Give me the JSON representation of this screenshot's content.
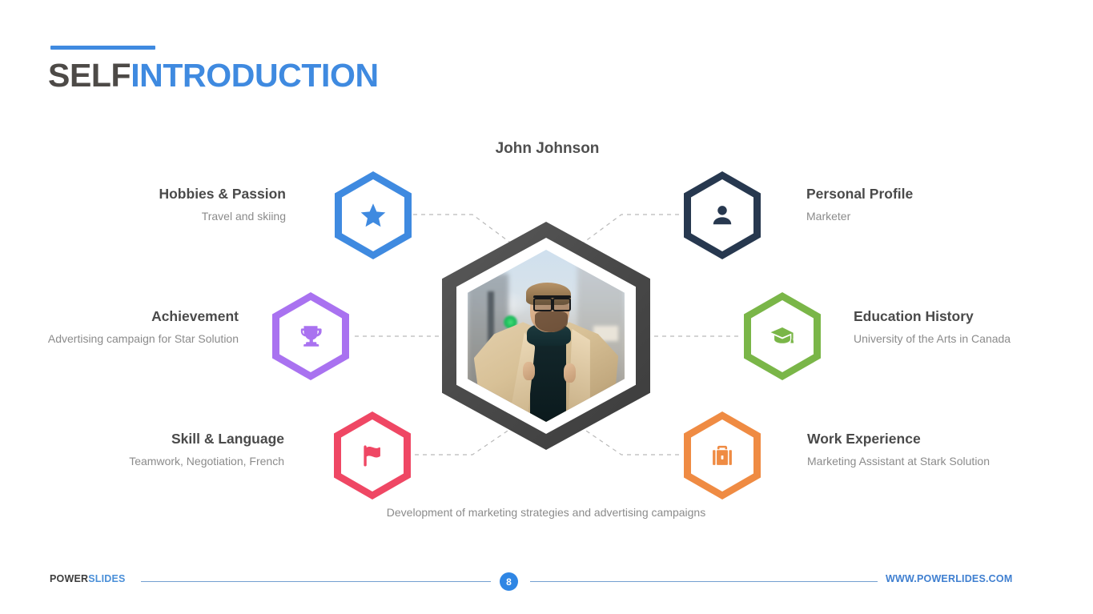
{
  "slide": {
    "title_part1": "SELF",
    "title_part2": "INTRODUCTION",
    "person_name": "John Johnson",
    "bottom_caption": "Development of marketing strategies and advertising campaigns"
  },
  "colors": {
    "accent_blue": "#3f8ae0",
    "title_dark": "#4d4a47",
    "hex_blue": "#3f8ae0",
    "hex_navy": "#27384f",
    "hex_purple": "#a濃",
    "hex_purple_hex": "#a972f0",
    "hex_green": "#7ab648",
    "hex_pink": "#ef4764",
    "hex_orange": "#ef8b43",
    "center_gray": "#4a4a4a",
    "body_gray": "#8b8b8b"
  },
  "entries": [
    {
      "key": "hobbies",
      "title": "Hobbies & Passion",
      "subtitle": "Travel and skiing",
      "icon": "star-icon",
      "color": "#3f8ae0",
      "side": "left"
    },
    {
      "key": "achievement",
      "title": "Achievement",
      "subtitle": "Advertising campaign for Star Solution",
      "icon": "trophy-icon",
      "color": "#a972f0",
      "side": "left"
    },
    {
      "key": "skill",
      "title": "Skill & Language",
      "subtitle": "Teamwork, Negotiation, French",
      "icon": "flag-icon",
      "color": "#ef4764",
      "side": "left"
    },
    {
      "key": "personal-profile",
      "title": "Personal Profile",
      "subtitle": "Marketer",
      "icon": "user-icon",
      "color": "#27384f",
      "side": "right"
    },
    {
      "key": "education",
      "title": "Education History",
      "subtitle": "University of the Arts in Canada",
      "icon": "graduation-cap-icon",
      "color": "#7ab648",
      "side": "right"
    },
    {
      "key": "work",
      "title": "Work Experience",
      "subtitle": "Marketing Assistant at Stark Solution",
      "icon": "briefcase-icon",
      "color": "#ef8b43",
      "side": "right"
    }
  ],
  "footer": {
    "logo_part1": "POWER",
    "logo_part2": "SLIDES",
    "page_number": "8",
    "url": "WWW.POWERLIDES.COM"
  }
}
